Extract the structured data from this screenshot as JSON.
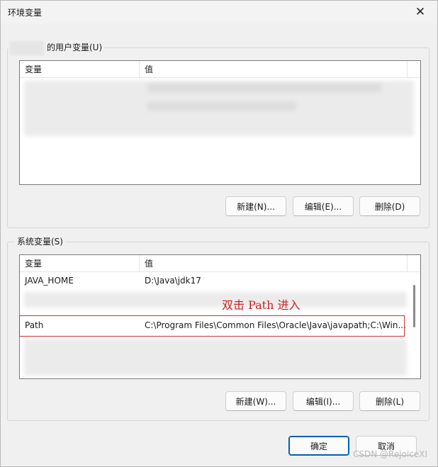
{
  "window": {
    "title": "环境变量",
    "close_glyph": "✕"
  },
  "user_vars": {
    "group_label": "的用户变量(U)",
    "columns": [
      "变量",
      "值"
    ],
    "buttons": {
      "new": "新建(N)...",
      "edit": "编辑(E)...",
      "delete": "删除(D)"
    }
  },
  "system_vars": {
    "group_label": "系统变量(S)",
    "columns": [
      "变量",
      "值"
    ],
    "rows": [
      {
        "name": "JAVA_HOME",
        "value": "D:\\Java\\jdk17"
      },
      {
        "name": "Path",
        "value": "C:\\Program Files\\Common Files\\Oracle\\Java\\javapath;C:\\Win..."
      }
    ],
    "buttons": {
      "new": "新建(W)...",
      "edit": "编辑(I)...",
      "delete": "删除(L)"
    }
  },
  "footer": {
    "ok": "确定",
    "cancel": "取消"
  },
  "annotation": {
    "text": "双击 Path 进入",
    "color": "#d02020"
  },
  "watermark": "CSDN @RejoiceXI"
}
